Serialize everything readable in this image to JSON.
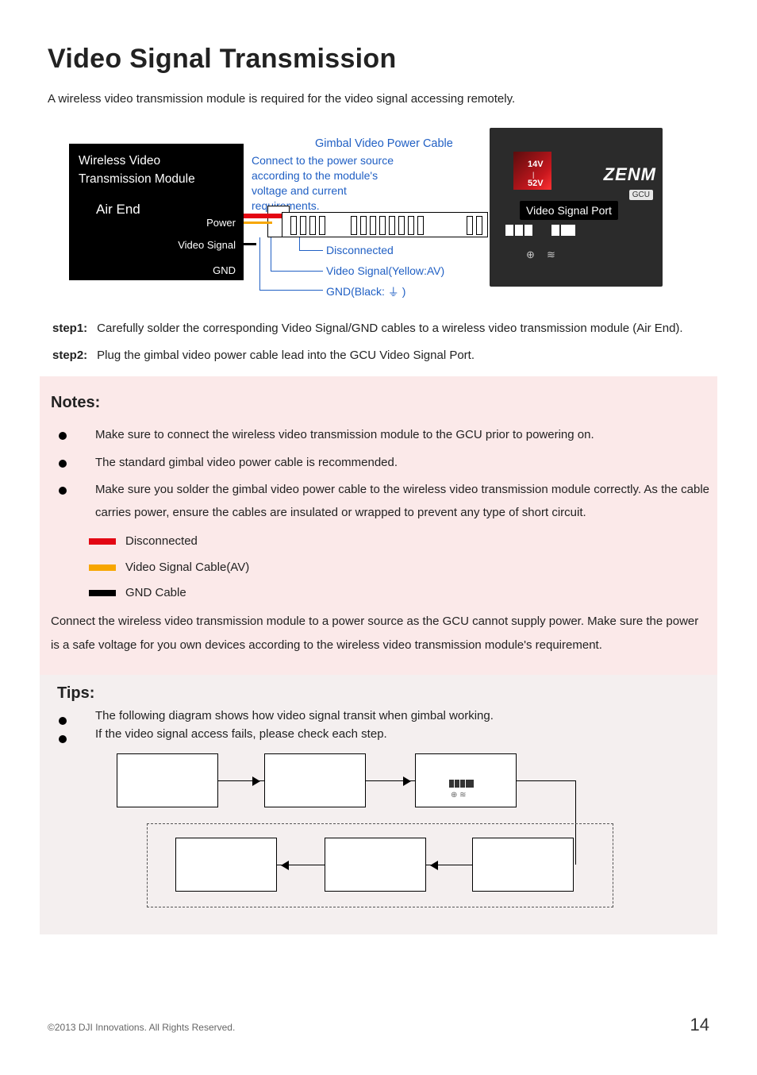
{
  "title": "Video Signal Transmission",
  "intro": "A wireless video transmission module is required for the video signal accessing remotely.",
  "diagram1": {
    "module_title1": "Wireless Video",
    "module_title2": "Transmission Module",
    "air_end": "Air End",
    "lbl_power": "Power",
    "lbl_video": "Video Signal",
    "lbl_gnd": "GND",
    "gvp_title": "Gimbal Video Power Cable",
    "connect_txt": "Connect to the power source according to the module's voltage and current requirements.",
    "call_disconnected": "Disconnected",
    "call_video": "Video Signal(Yellow:AV)",
    "call_gnd_a": "GND(Black:",
    "call_gnd_b": ")",
    "gcu": {
      "v14": "14V",
      "v52": "52V",
      "brand": "ZENM",
      "gcu_tag": "GCU",
      "vsp_label": "Video Signal Port"
    }
  },
  "steps": {
    "s1_label": "step1:",
    "s1_text": "Carefully solder the corresponding Video Signal/GND cables to a wireless video transmission module (Air End).",
    "s2_label": "step2:",
    "s2_text": "Plug the gimbal video power cable lead into the GCU Video Signal Port."
  },
  "notes": {
    "heading": "Notes:",
    "items": [
      "Make sure to connect the wireless video transmission module to the GCU prior to powering on.",
      "The standard gimbal video power cable is recommended.",
      "Make sure you solder the gimbal video power cable to the wireless video transmission module correctly. As the cable carries power, ensure the cables are insulated or wrapped to prevent any type of short circuit."
    ],
    "legend": {
      "disconnected": "Disconnected",
      "video": "Video Signal Cable(AV)",
      "gnd": "GND Cable"
    },
    "bottom_text": "Connect the wireless video transmission module to a power source as the GCU cannot supply power. Make sure the power is a safe voltage for you own devices according to the wireless video transmission module's requirement."
  },
  "tips": {
    "heading": "Tips:",
    "items": [
      "The following diagram shows how video signal transit when gimbal working.",
      "If the video signal access fails, please check each step."
    ]
  },
  "footer": {
    "copyright": "©2013 DJI Innovations. All Rights Reserved.",
    "page": "14"
  }
}
